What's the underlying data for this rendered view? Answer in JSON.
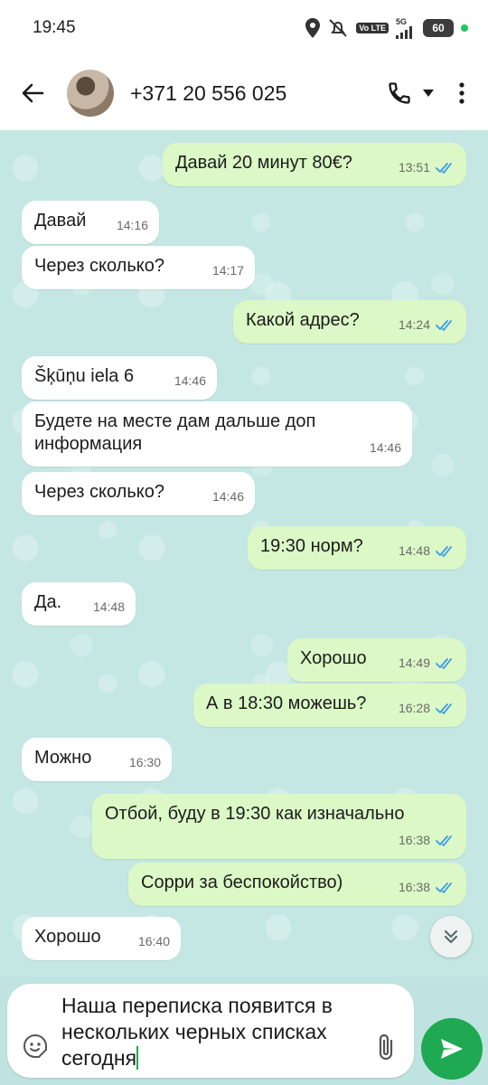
{
  "status_bar": {
    "time": "19:45",
    "battery": "60",
    "network": "5G",
    "volte": "Vo LTE"
  },
  "header": {
    "contact": "+371 20 556 025"
  },
  "messages": [
    {
      "dir": "out",
      "text": "Давай 20 минут 80€?",
      "time": "13:51",
      "read": true
    },
    {
      "dir": "in",
      "text": "Давай",
      "time": "14:16"
    },
    {
      "dir": "in",
      "text": "Через сколько?",
      "time": "14:17"
    },
    {
      "dir": "out",
      "text": "Какой адрес?",
      "time": "14:24",
      "read": true
    },
    {
      "dir": "in",
      "text": "Šķūņu iela 6",
      "time": "14:46"
    },
    {
      "dir": "in",
      "text": "Будете на месте дам дальше доп информация",
      "time": "14:46"
    },
    {
      "dir": "in",
      "text": "Через сколько?",
      "time": "14:46"
    },
    {
      "dir": "out",
      "text": "19:30 норм?",
      "time": "14:48",
      "read": true
    },
    {
      "dir": "in",
      "text": "Да.",
      "time": "14:48"
    },
    {
      "dir": "out",
      "text": "Хорошо",
      "time": "14:49",
      "read": true
    },
    {
      "dir": "out",
      "text": "А в 18:30 можешь?",
      "time": "16:28",
      "read": true
    },
    {
      "dir": "in",
      "text": "Можно",
      "time": "16:30"
    },
    {
      "dir": "out",
      "text": "Отбой, буду в 19:30 как изначально",
      "time": "16:38",
      "read": true
    },
    {
      "dir": "out",
      "text": "Сорри за беспокойство)",
      "time": "16:38",
      "read": true
    },
    {
      "dir": "in",
      "text": "Хорошо",
      "time": "16:40"
    }
  ],
  "composer": {
    "text": "Наша переписка появится в нескольких черных списках сегодня"
  },
  "colors": {
    "tick_read": "#3b9be8",
    "send": "#1ea952",
    "outgoing": "#dbf8c6"
  }
}
